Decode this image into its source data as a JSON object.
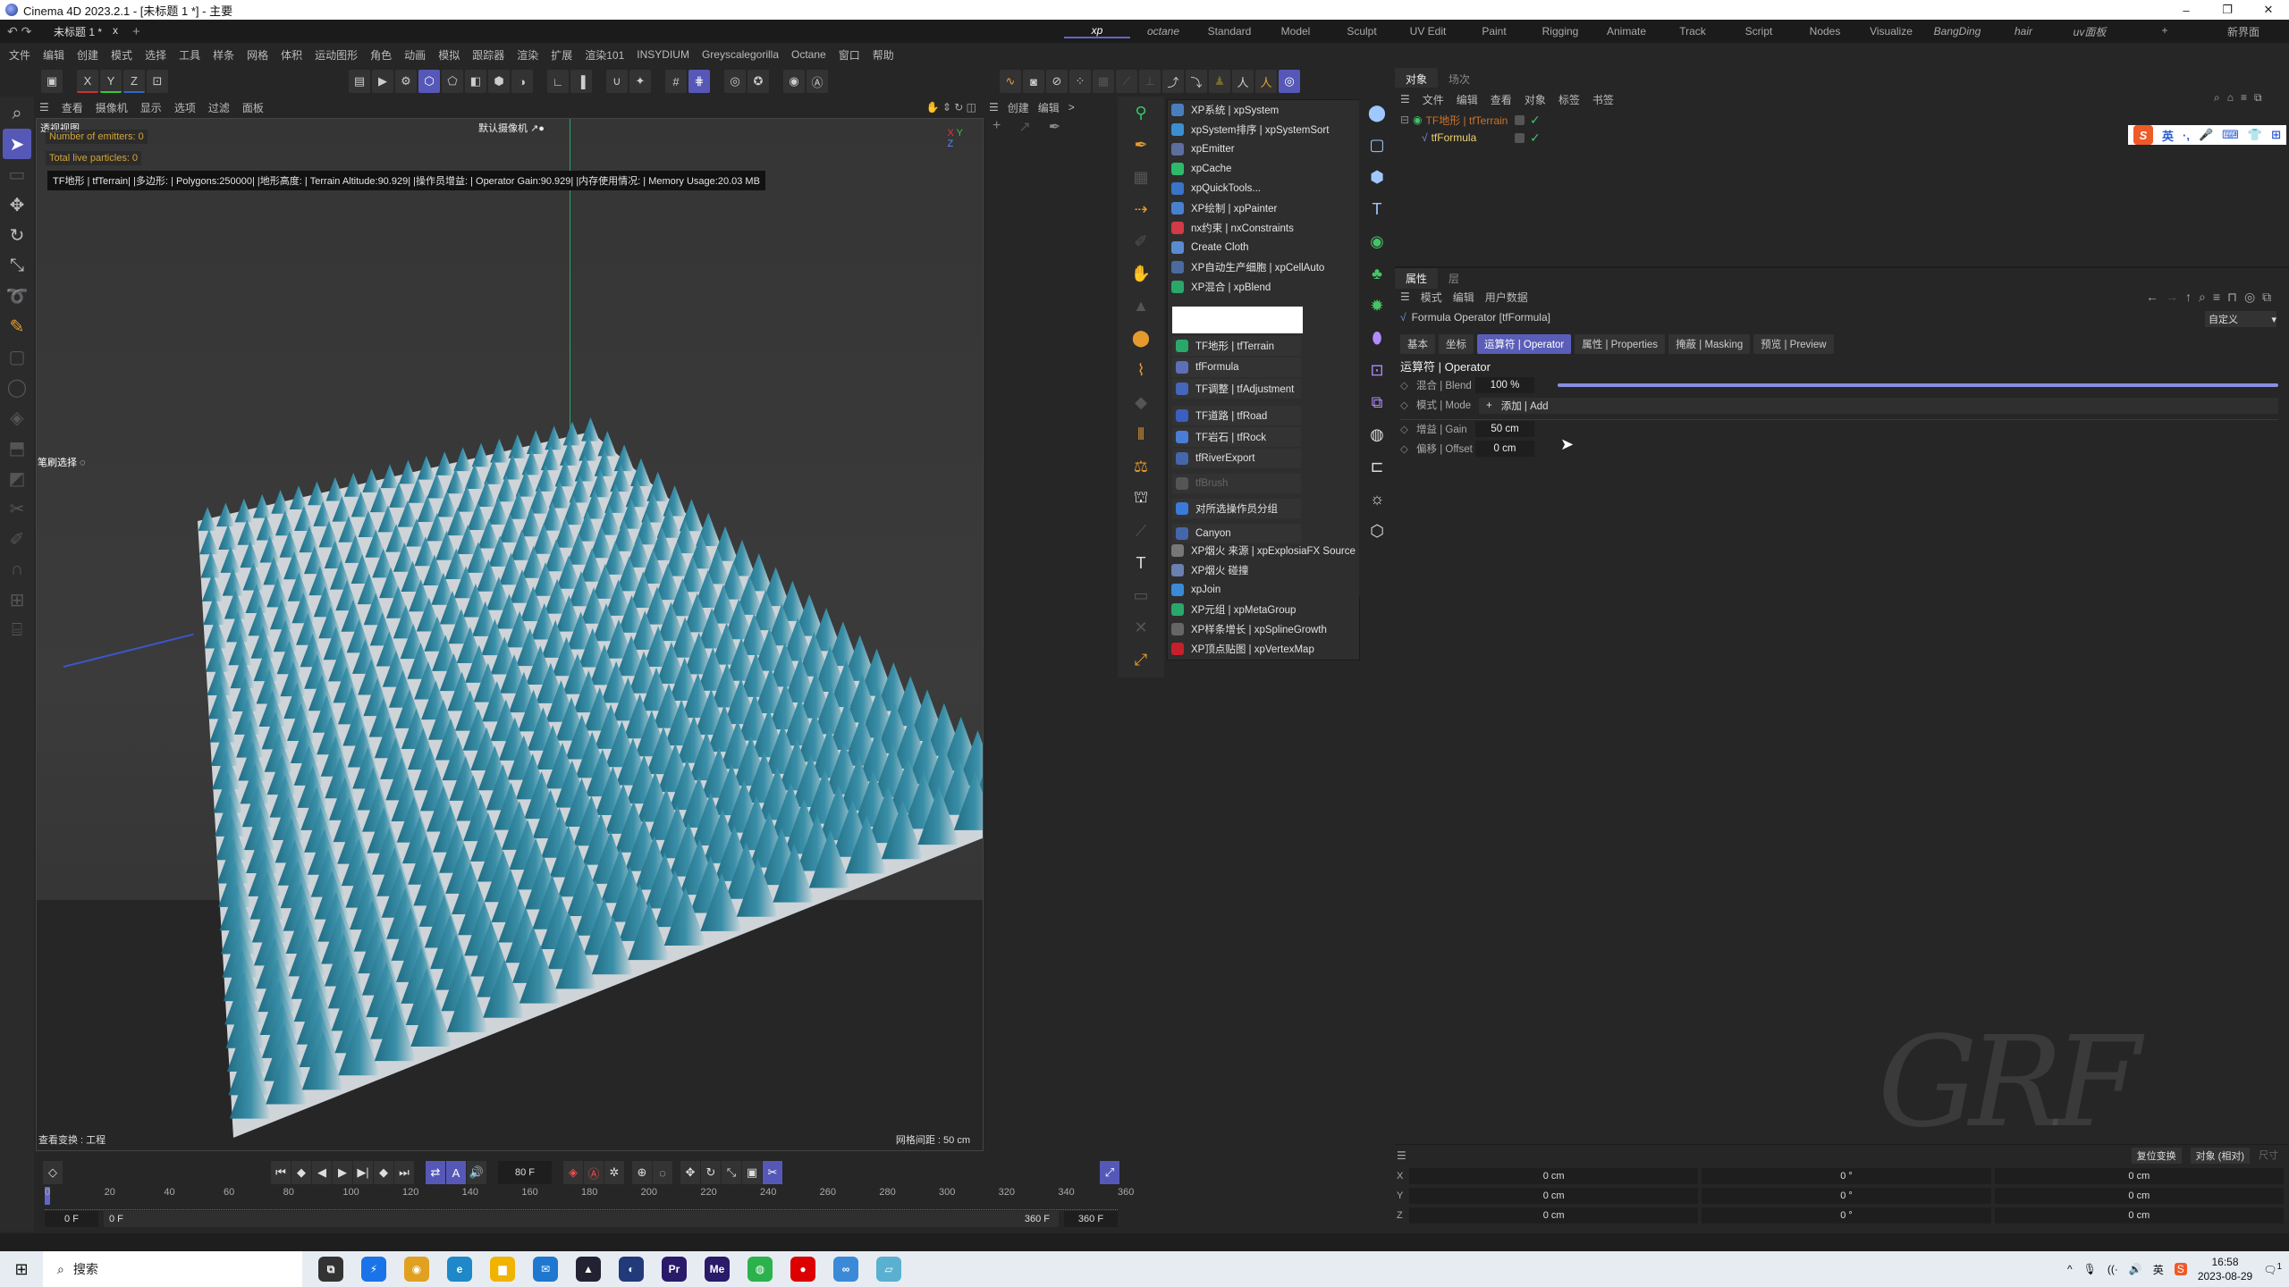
{
  "window": {
    "title": "Cinema 4D 2023.2.1 - [未标题 1 *] - 主要",
    "controls": [
      "–",
      "❐",
      "✕"
    ]
  },
  "tabs": {
    "doc_tab": "未标题 1 *",
    "close": "x",
    "new": "+"
  },
  "layouts": {
    "items": [
      "xp",
      "octane",
      "Standard",
      "Model",
      "Sculpt",
      "UV Edit",
      "Paint",
      "Rigging",
      "Animate",
      "Track",
      "Script",
      "Nodes",
      "Visualize",
      "BangDing",
      "hair",
      "uv面板"
    ],
    "active": "xp",
    "add": "+",
    "new_ui": "新界面"
  },
  "menubar": [
    "文件",
    "编辑",
    "创建",
    "模式",
    "选择",
    "工具",
    "样条",
    "网格",
    "体积",
    "运动图形",
    "角色",
    "动画",
    "模拟",
    "跟踪器",
    "渲染",
    "扩展",
    "渲染101",
    "INSYDIUM",
    "Greyscalegorilla",
    "Octane",
    "窗口",
    "帮助"
  ],
  "toolbar": {
    "axis": [
      "X",
      "Y",
      "Z"
    ]
  },
  "viewport": {
    "menu": [
      "查看",
      "摄像机",
      "显示",
      "选项",
      "过滤",
      "面板"
    ],
    "title": "透视视图",
    "camera": "默认摄像机 ↗●",
    "emitters": "Number of emitters: 0",
    "particles": "Total live particles: 0",
    "hud": "TF地形 | tfTerrain| |多边形:   | Polygons:250000| |地形高度:   | Terrain Altitude:90.929| |操作员增益:   | Operator Gain:90.929| |内存使用情况:   | Memory Usage:20.03 MB",
    "brush_select": "笔刷选择 ◌",
    "view_transform": "查看变换 : 工程",
    "grid_spacing": "网格间距 : 50 cm",
    "axis_gizmo": {
      "x": "X",
      "y": "Y",
      "z": "Z"
    }
  },
  "attr_mini": {
    "menu": [
      "创建",
      "编辑",
      ">"
    ]
  },
  "plugin_menu": {
    "items": [
      {
        "label": "XP系统 | xpSystem",
        "color": "#4a7fbf"
      },
      {
        "label": "xpSystem排序 | xpSystemSort",
        "color": "#3b8fd0"
      },
      {
        "label": "xpEmitter",
        "color": "#5c6f9f"
      },
      {
        "label": "xpCache",
        "color": "#2dbb6a"
      },
      {
        "label": "xpQuickTools...",
        "color": "#3a73c8"
      },
      {
        "label": "XP绘制 | xpPainter",
        "color": "#4a80d0"
      },
      {
        "label": "nx约束 | nxConstraints",
        "color": "#d23a45"
      },
      {
        "label": "Create Cloth",
        "color": "#5a8bd0"
      },
      {
        "label": "XP自动生产细胞 | xpCellAuto",
        "color": "#4a6aa0"
      },
      {
        "label": "XP混合 | xpBlend",
        "color": "#2aa86a"
      }
    ],
    "tf_items": [
      {
        "label": "TF地形 | tfTerrain",
        "color": "#2aa86a"
      },
      {
        "label": "tfFormula",
        "color": "#5d6fb8"
      },
      {
        "label": "TF调整 | tfAdjustment",
        "color": "#4466bb"
      },
      {
        "label": "TF道路 | tfRoad",
        "color": "#3b5fc0"
      },
      {
        "label": "TF岩石 | tfRock",
        "color": "#4a7ed6"
      },
      {
        "label": "tfRiverExport",
        "color": "#4466aa"
      },
      {
        "label": "tfBrush",
        "color": "#555"
      },
      {
        "label": "对所选操作员分组",
        "color": "#3b7ad8"
      },
      {
        "label": "Canyon",
        "color": "#4466aa"
      }
    ],
    "fx_items": [
      {
        "label": "XP烟火 来源 | xpExplosiaFX Source",
        "color": "#777"
      },
      {
        "label": "XP烟火 碰撞",
        "color": "#6a80b0"
      },
      {
        "label": "xpJoin",
        "color": "#3a8ad8"
      },
      {
        "label": "XP元组 | xpMetaGroup",
        "color": "#2aa86a"
      },
      {
        "label": "XP样条增长 | xpSplineGrowth",
        "color": "#666"
      },
      {
        "label": "XP顶点贴图 | xpVertexMap",
        "color": "#c8202a"
      }
    ]
  },
  "object_manager": {
    "tabs": [
      "对象",
      "场次"
    ],
    "menu": [
      "文件",
      "编辑",
      "查看",
      "对象",
      "标签",
      "书签"
    ],
    "objects": [
      {
        "name": "TF地形 | tfTerrain",
        "enabled": "✓"
      },
      {
        "name": "tfFormula",
        "enabled": "✓"
      }
    ]
  },
  "ime": {
    "logo": "S",
    "items": [
      "英",
      "·,",
      "🎤",
      "⌨",
      "👕",
      "⊞"
    ]
  },
  "attributes": {
    "tabs": [
      "属性",
      "层"
    ],
    "menu": [
      "模式",
      "编辑",
      "用户数据"
    ],
    "object_title": "Formula Operator [tfFormula]",
    "preset": "自定义",
    "op_tabs": [
      "基本",
      "坐标",
      "运算符 | Operator",
      "属性 | Properties",
      "掩蔽 | Masking",
      "预览 | Preview"
    ],
    "active_tab": "运算符 | Operator",
    "section": "运算符 | Operator",
    "params": [
      {
        "label": "混合 | Blend",
        "value": "100 %",
        "fraction": 1.0
      },
      {
        "label": "模式 | Mode",
        "value": "添加 | Add"
      },
      {
        "label": "增益 | Gain",
        "value": "50 cm"
      },
      {
        "label": "偏移 | Offset",
        "value": "0 cm"
      }
    ]
  },
  "coordinates": {
    "reset": "复位变换",
    "mode": "对象 (相对)",
    "size": "尺寸",
    "rows": [
      {
        "axis": "X",
        "pos": "0 cm",
        "rot": "0 °",
        "scale": "0 cm"
      },
      {
        "axis": "Y",
        "pos": "0 cm",
        "rot": "0 °",
        "scale": "0 cm"
      },
      {
        "axis": "Z",
        "pos": "0 cm",
        "rot": "0 °",
        "scale": "0 cm"
      }
    ]
  },
  "timeline": {
    "current_frame": "80 F",
    "ticks": [
      "0",
      "20",
      "40",
      "60",
      "80",
      "100",
      "120",
      "140",
      "160",
      "180",
      "200",
      "220",
      "240",
      "260",
      "280",
      "300",
      "320",
      "340",
      "360"
    ],
    "start": "0 F",
    "range_start": "0 F",
    "range_end": "360 F",
    "end": "360 F",
    "playhead_frame": 0
  },
  "watermark": "GRF",
  "taskbar": {
    "search": "搜索",
    "apps": [
      {
        "name": "task-view",
        "glyph": "⧉",
        "color": "#333"
      },
      {
        "name": "thunder",
        "glyph": "⚡",
        "color": "#1a73e8"
      },
      {
        "name": "chrome",
        "glyph": "◉",
        "color": "#e0a020"
      },
      {
        "name": "edge",
        "glyph": "e",
        "color": "#1e88c8"
      },
      {
        "name": "explorer",
        "glyph": "▆",
        "color": "#f0b400"
      },
      {
        "name": "mail",
        "glyph": "✉",
        "color": "#1e78d0"
      },
      {
        "name": "cat-app",
        "glyph": "▲",
        "color": "#223"
      },
      {
        "name": "cinema4d",
        "glyph": "◐",
        "color": "#223a7a"
      },
      {
        "name": "premiere",
        "glyph": "Pr",
        "color": "#2a1a6a"
      },
      {
        "name": "media-encoder",
        "glyph": "Me",
        "color": "#2a1a6a"
      },
      {
        "name": "wechat",
        "glyph": "◍",
        "color": "#2bb24c"
      },
      {
        "name": "recorder",
        "glyph": "●",
        "color": "#d00"
      },
      {
        "name": "baidu-netdisk",
        "glyph": "∞",
        "color": "#3a8ad8"
      },
      {
        "name": "notepad",
        "glyph": "▱",
        "color": "#5ab0d0"
      }
    ],
    "tray": {
      "chevron": "^",
      "mic": "🎙",
      "wifi": "((·",
      "vol": "🔊",
      "lang": "英",
      "ime": "S",
      "time": "16:58",
      "date": "2023-08-29",
      "notif": "1"
    }
  }
}
